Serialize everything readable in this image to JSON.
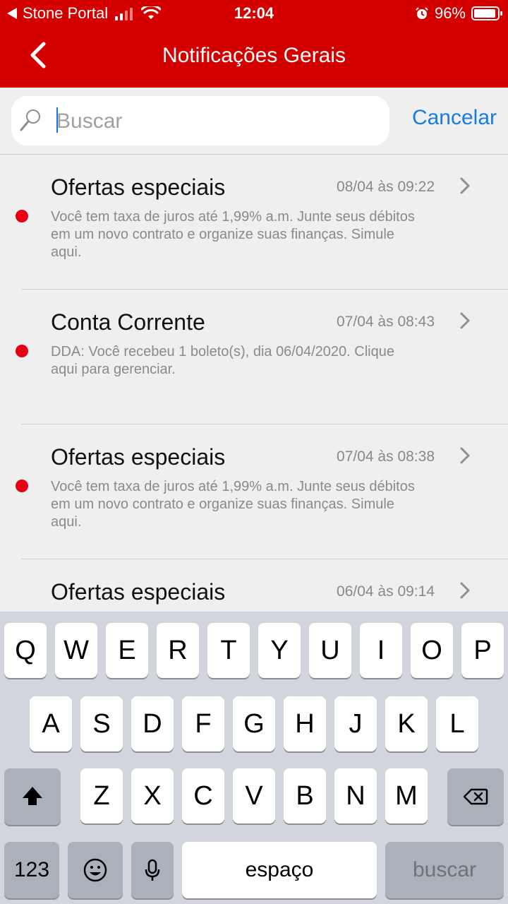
{
  "status": {
    "carrier": "Stone Portal",
    "time": "12:04",
    "battery": "96%"
  },
  "header": {
    "title": "Notificações Gerais"
  },
  "search": {
    "placeholder": "Buscar",
    "cancel_label": "Cancelar"
  },
  "notifications": [
    {
      "title": "Ofertas especiais",
      "date": "08/04 às 09:22",
      "text": "Você tem taxa de juros até 1,99% a.m. Junte seus débitos em um novo contrato e organize suas finanças. Simule aqui."
    },
    {
      "title": "Conta Corrente",
      "date": "07/04 às 08:43",
      "text": "DDA: Você recebeu 1 boleto(s), dia 06/04/2020. Clique aqui para gerenciar."
    },
    {
      "title": "Ofertas especiais",
      "date": "07/04 às 08:38",
      "text": "Você tem taxa de juros até 1,99% a.m. Junte seus débitos em um novo contrato e organize suas finanças. Simule aqui."
    },
    {
      "title": "Ofertas especiais",
      "date": "06/04 às 09:14",
      "text": ""
    }
  ],
  "keyboard": {
    "row1": [
      "Q",
      "W",
      "E",
      "R",
      "T",
      "Y",
      "U",
      "I",
      "O",
      "P"
    ],
    "row2": [
      "A",
      "S",
      "D",
      "F",
      "G",
      "H",
      "J",
      "K",
      "L"
    ],
    "row3": [
      "Z",
      "X",
      "C",
      "V",
      "B",
      "N",
      "M"
    ],
    "numbers_label": "123",
    "space_label": "espaço",
    "search_label": "buscar"
  },
  "colors": {
    "header_bg": "#d40000",
    "accent_blue": "#1a7be0",
    "unread_dot": "#e60014"
  }
}
